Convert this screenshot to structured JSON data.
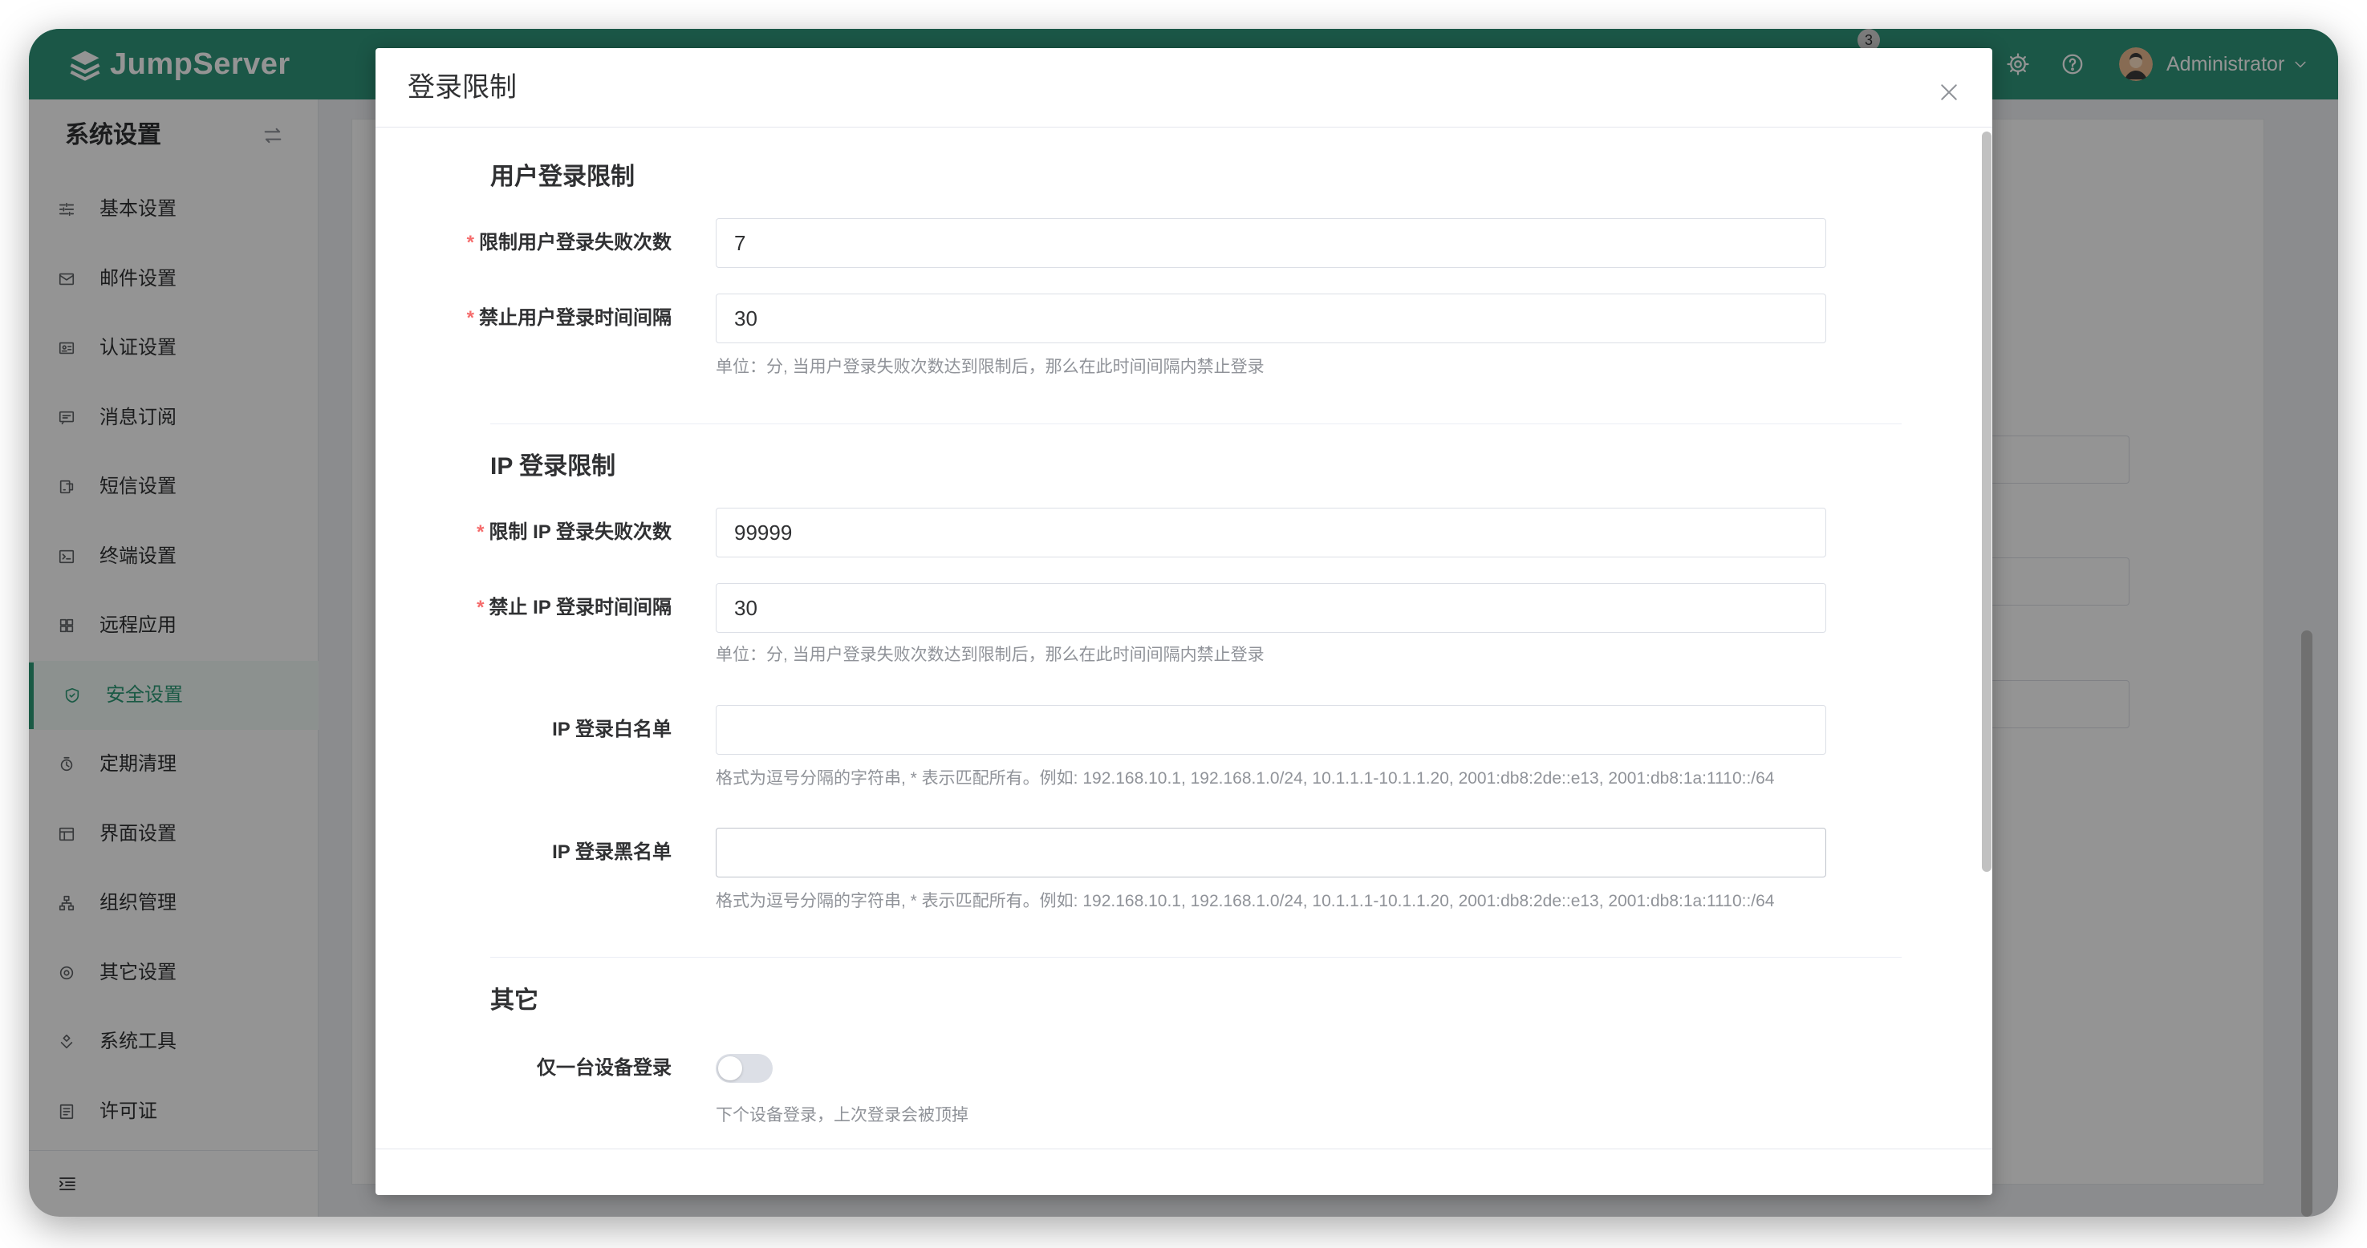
{
  "header": {
    "logo_text": "JumpServer",
    "notification_count": "3",
    "user_name": "Administrator"
  },
  "sidebar": {
    "title": "系统设置",
    "items": [
      {
        "label": "基本设置",
        "icon": "sliders-icon"
      },
      {
        "label": "邮件设置",
        "icon": "mail-icon"
      },
      {
        "label": "认证设置",
        "icon": "id-card-icon"
      },
      {
        "label": "消息订阅",
        "icon": "message-icon"
      },
      {
        "label": "短信设置",
        "icon": "sms-icon"
      },
      {
        "label": "终端设置",
        "icon": "terminal-icon"
      },
      {
        "label": "远程应用",
        "icon": "apps-icon"
      },
      {
        "label": "安全设置",
        "icon": "shield-icon",
        "active": true
      },
      {
        "label": "定期清理",
        "icon": "clean-icon"
      },
      {
        "label": "界面设置",
        "icon": "layout-icon"
      },
      {
        "label": "组织管理",
        "icon": "org-icon"
      },
      {
        "label": "其它设置",
        "icon": "other-icon"
      },
      {
        "label": "系统工具",
        "icon": "tools-icon"
      },
      {
        "label": "许可证",
        "icon": "license-icon"
      }
    ]
  },
  "modal": {
    "title": "登录限制",
    "required_mark": "*",
    "user_section": {
      "title": "用户登录限制",
      "fail_limit": {
        "label": "限制用户登录失败次数",
        "value": "7"
      },
      "block_interval": {
        "label": "禁止用户登录时间间隔",
        "value": "30",
        "help": "单位：分, 当用户登录失败次数达到限制后，那么在此时间间隔内禁止登录"
      }
    },
    "ip_section": {
      "title": "IP 登录限制",
      "fail_limit": {
        "label": "限制 IP 登录失败次数",
        "value": "99999"
      },
      "block_interval": {
        "label": "禁止 IP 登录时间间隔",
        "value": "30",
        "help": "单位：分, 当用户登录失败次数达到限制后，那么在此时间间隔内禁止登录"
      },
      "whitelist": {
        "label": "IP 登录白名单",
        "value": "",
        "help": "格式为逗号分隔的字符串, * 表示匹配所有。例如: 192.168.10.1, 192.168.1.0/24, 10.1.1.1-10.1.1.20, 2001:db8:2de::e13, 2001:db8:1a:1110::/64"
      },
      "blacklist": {
        "label": "IP 登录黑名单",
        "value": "",
        "help": "格式为逗号分隔的字符串, * 表示匹配所有。例如: 192.168.10.1, 192.168.1.0/24, 10.1.1.1-10.1.1.20, 2001:db8:2de::e13, 2001:db8:1a:1110::/64"
      }
    },
    "other_section": {
      "title": "其它",
      "single_device": {
        "label": "仅一台设备登录",
        "enabled": false,
        "help": "下个设备登录，上次登录会被顶掉"
      }
    }
  },
  "colors": {
    "brand": "#30977a",
    "active": "#2e9b77",
    "required": "#f56c6c"
  }
}
